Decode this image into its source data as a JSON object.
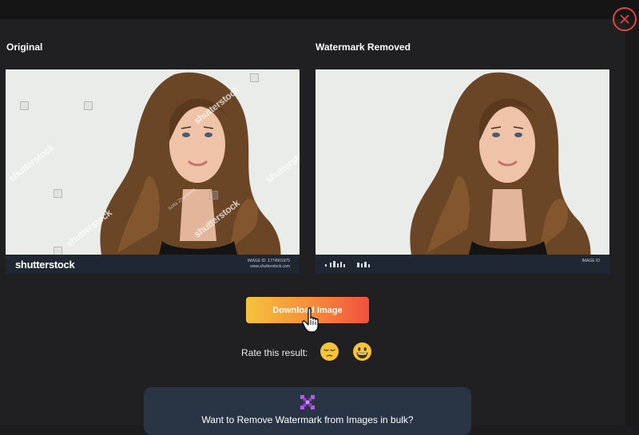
{
  "panels": {
    "original": {
      "title": "Original",
      "brand": "shutterstock",
      "footer_meta": [
        "IMAGE ID: 1774901975",
        "www.shutterstock.com"
      ],
      "watermark_text": "shutterstock",
      "watermark_small": "Sofia Zhuravetz"
    },
    "removed": {
      "title": "Watermark Removed",
      "footer_meta": [
        "IMAGE ID"
      ]
    }
  },
  "actions": {
    "download_label": "Download Image"
  },
  "rating": {
    "label": "Rate this result:",
    "options": [
      "pensive-face",
      "grinning-face"
    ]
  },
  "bulk": {
    "text": "Want to Remove Watermark from Images in bulk?"
  },
  "colors": {
    "close": "#e0453f",
    "bulk_icon": "#b65cf0",
    "button_start": "#f5c33d",
    "button_end": "#f0513f"
  }
}
